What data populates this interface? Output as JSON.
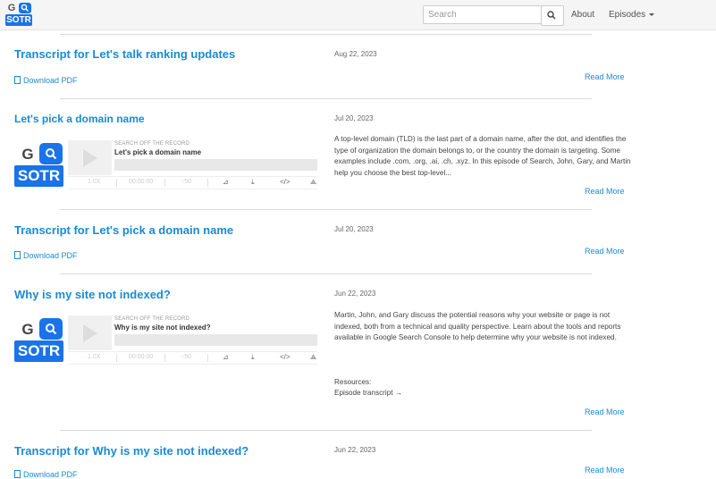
{
  "logo": {
    "g": "G",
    "sotr": "SOTR"
  },
  "search": {
    "placeholder": "Search"
  },
  "nav": {
    "about": "About",
    "episodes": "Episodes"
  },
  "entries": [
    {
      "title": "Transcript for Let's talk ranking updates",
      "date": "Aug 22, 2023",
      "pdf": "Download PDF",
      "read_more": "Read More"
    },
    {
      "title": "Let's pick a domain name",
      "date": "Jul 20, 2023",
      "player": {
        "g": "G",
        "sotr": "SOTR",
        "source": "SEARCH OFF THE RECORD",
        "title": "Let's pick a domain name",
        "speed": "1.0X",
        "time": "00:00:00",
        "skip": "-:50"
      },
      "description": "A top-level domain (TLD) is the last part of a domain name, after the dot, and identifies the type of organization the domain belongs to, or the country the domain is targeting. Some examples include .com, .org, .ai, .ch, .xyz. In this episode of Search, John, Gary, and Martin help you choose the best top-level...",
      "read_more": "Read More"
    },
    {
      "title": "Transcript for Let's pick a domain name",
      "date": "Jul 20, 2023",
      "pdf": "Download PDF",
      "read_more": "Read More"
    },
    {
      "title": "Why is my site not indexed?",
      "date": "Jun 22, 2023",
      "player": {
        "g": "G",
        "sotr": "SOTR",
        "source": "SEARCH OFF THE RECORD",
        "title": "Why is my site not indexed?",
        "speed": "1.0X",
        "time": "00:00:00",
        "skip": "-:50"
      },
      "description": "Martin, John, and Gary discuss the potential reasons why your website or page is not indexed, both from a technical and quality perspective. Learn about the tools and reports available in Google Search Console to help determine why your website is not indexed.",
      "resources": "Resources:",
      "resource_link": "Episode transcript →",
      "read_more": "Read More"
    },
    {
      "title": "Transcript for Why is my site not indexed?",
      "date": "Jun 22, 2023",
      "pdf": "Download PDF",
      "read_more": "Read More"
    }
  ]
}
